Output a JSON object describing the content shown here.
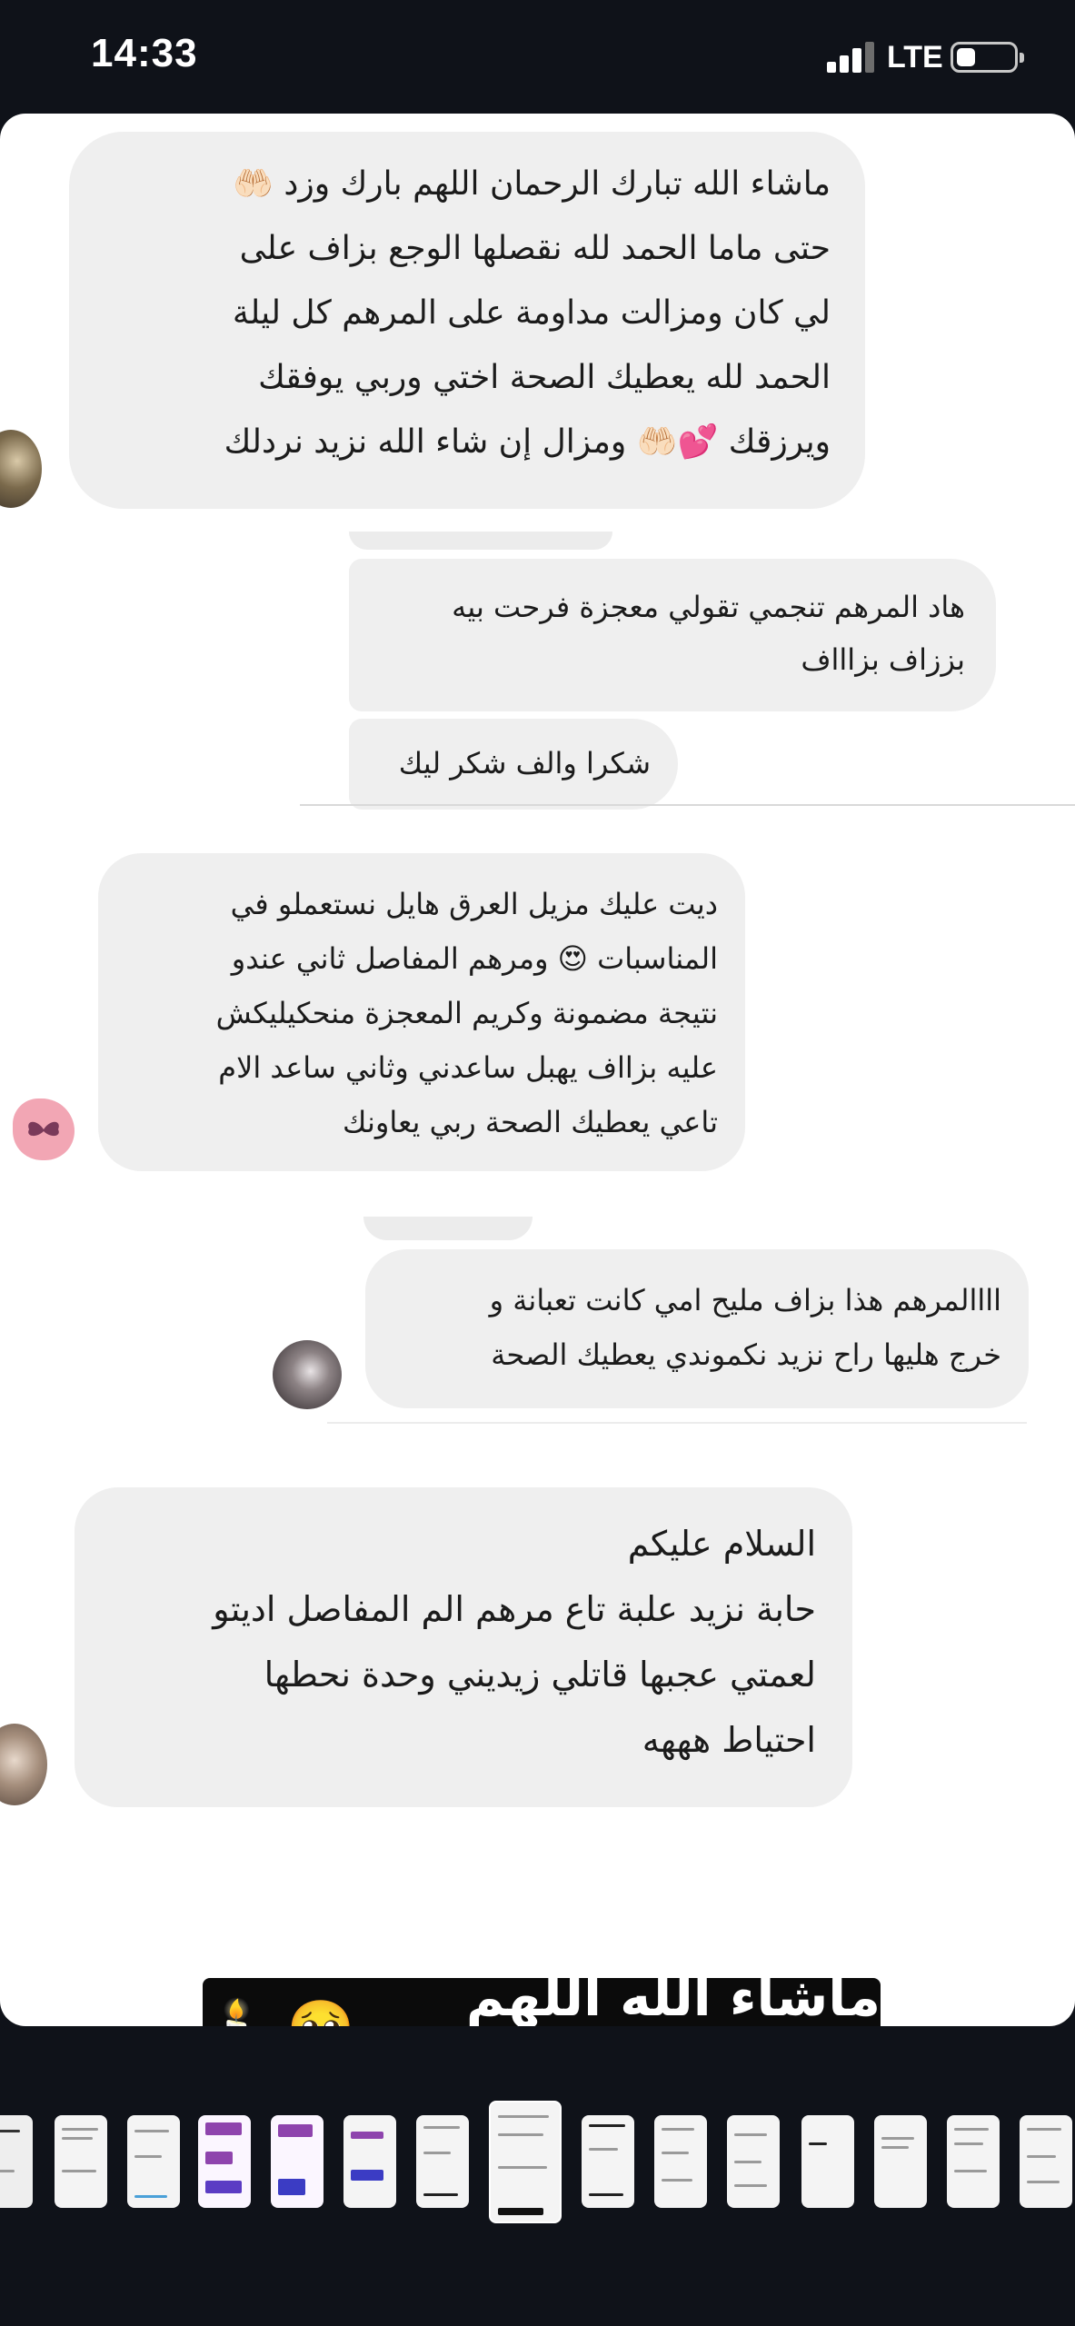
{
  "status_bar": {
    "time": "14:33",
    "network": "LTE",
    "icons": [
      "signal-bars-icon",
      "battery-icon"
    ]
  },
  "messages": [
    {
      "lines": [
        "ماشاء الله تبارك الرحمان اللهم بارك وزد 🤲🏻",
        "حتى ماما الحمد لله نقصلها الوجع بزاف على",
        "لي كان ومزالت مداومة على المرهم كل ليلة",
        "الحمد لله يعطيك الصحة اختي وربي يوفقك",
        "ويرزقك 💕🤲🏻 ومزال إن شاء الله نزيد نردلك"
      ]
    },
    {
      "lines": [
        "هاد المرهم تنجمي تقولي معجزة فرحت بيه",
        "بززاف بزاااف"
      ]
    },
    {
      "lines": [
        "شكرا والف شكر ليك"
      ]
    },
    {
      "lines": [
        "ديت عليك مزيل العرق هايل نستعملو في",
        "المناسبات 😍 ومرهم المفاصل ثاني عندو",
        "نتيجة مضمونة  وكريم المعجزة منحكيليكش",
        "عليه بزااف يهبل ساعدني وثاني ساعد الام",
        "تاعي  يعطيك الصحة ربي يعاونك"
      ]
    },
    {
      "lines": [
        "اااالمرهم هذا بزاف مليح امي كانت تعبانة و",
        "خرج هليها راح نزيد نكموندي يعطيك الصحة"
      ]
    },
    {
      "lines": [
        "السلام عليكم",
        "حابة نزيد علبة تاع مرهم الم المفاصل اديتو",
        "لعمتي عجبها قاتلي زيديني وحدة نحطها",
        "احتياط هههه"
      ]
    }
  ],
  "caption": {
    "text": "ماشاء الله اللهم بارك",
    "emojis": [
      "🥺",
      "🕯️"
    ]
  },
  "thumbnails": {
    "count": 15,
    "active_index": 7
  },
  "colors": {
    "background": "#0f1219",
    "card": "#ffffff",
    "bubble": "#efefef",
    "caption_bg": "#0b0b0b"
  }
}
